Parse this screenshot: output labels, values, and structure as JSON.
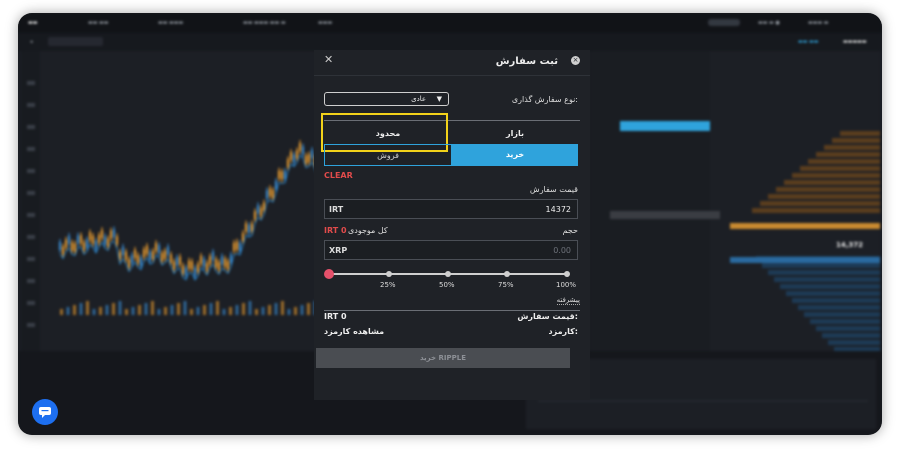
{
  "modal": {
    "title": "ثبت سفارش",
    "close_icon": "close-icon",
    "info_icon": "info-icon",
    "order_type_label": "نوع سفارش گذاری:",
    "order_type_selected": "عادی",
    "tabs": {
      "market": "بازار",
      "limit": "محدود"
    },
    "sides": {
      "buy": "خرید",
      "sell": "فروش"
    },
    "clear": "CLEAR",
    "price_label": "قیمت سفارش",
    "price_unit": "IRT",
    "price_value": "14372",
    "volume_label": "حجم",
    "balance_label": "کل موجودی",
    "balance_value": "IRT 0",
    "volume_unit": "XRP",
    "volume_placeholder": "0.00",
    "slider": {
      "value_percent": 0,
      "marks": [
        "25%",
        "50%",
        "75%",
        "100%"
      ]
    },
    "advanced": "پیشرفته",
    "order_price_label": "قیمت سفارش:",
    "order_price_value": "IRT 0",
    "fee_label": "کارمزد:",
    "fee_value": "مشاهده کارمزد",
    "submit": "خرید RIPPLE"
  },
  "colors": {
    "accent": "#2fa3dc",
    "danger": "#e14b4b",
    "highlight": "#f2d21a",
    "slider_thumb": "#e5516b"
  },
  "background": {
    "price_display": "14,372"
  }
}
